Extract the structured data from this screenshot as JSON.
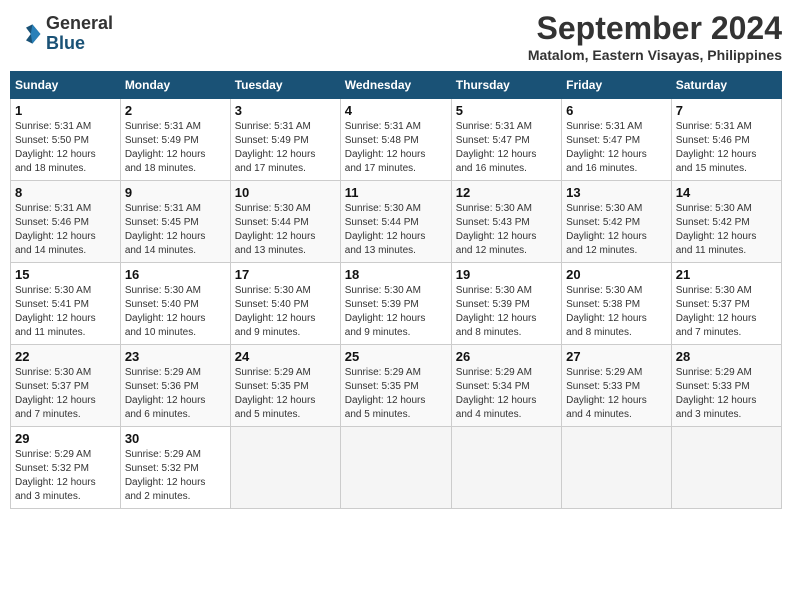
{
  "header": {
    "logo_line1": "General",
    "logo_line2": "Blue",
    "month": "September 2024",
    "location": "Matalom, Eastern Visayas, Philippines"
  },
  "weekdays": [
    "Sunday",
    "Monday",
    "Tuesday",
    "Wednesday",
    "Thursday",
    "Friday",
    "Saturday"
  ],
  "weeks": [
    [
      {
        "day": "1",
        "info": "Sunrise: 5:31 AM\nSunset: 5:50 PM\nDaylight: 12 hours\nand 18 minutes."
      },
      {
        "day": "2",
        "info": "Sunrise: 5:31 AM\nSunset: 5:49 PM\nDaylight: 12 hours\nand 18 minutes."
      },
      {
        "day": "3",
        "info": "Sunrise: 5:31 AM\nSunset: 5:49 PM\nDaylight: 12 hours\nand 17 minutes."
      },
      {
        "day": "4",
        "info": "Sunrise: 5:31 AM\nSunset: 5:48 PM\nDaylight: 12 hours\nand 17 minutes."
      },
      {
        "day": "5",
        "info": "Sunrise: 5:31 AM\nSunset: 5:47 PM\nDaylight: 12 hours\nand 16 minutes."
      },
      {
        "day": "6",
        "info": "Sunrise: 5:31 AM\nSunset: 5:47 PM\nDaylight: 12 hours\nand 16 minutes."
      },
      {
        "day": "7",
        "info": "Sunrise: 5:31 AM\nSunset: 5:46 PM\nDaylight: 12 hours\nand 15 minutes."
      }
    ],
    [
      {
        "day": "8",
        "info": "Sunrise: 5:31 AM\nSunset: 5:46 PM\nDaylight: 12 hours\nand 14 minutes."
      },
      {
        "day": "9",
        "info": "Sunrise: 5:31 AM\nSunset: 5:45 PM\nDaylight: 12 hours\nand 14 minutes."
      },
      {
        "day": "10",
        "info": "Sunrise: 5:30 AM\nSunset: 5:44 PM\nDaylight: 12 hours\nand 13 minutes."
      },
      {
        "day": "11",
        "info": "Sunrise: 5:30 AM\nSunset: 5:44 PM\nDaylight: 12 hours\nand 13 minutes."
      },
      {
        "day": "12",
        "info": "Sunrise: 5:30 AM\nSunset: 5:43 PM\nDaylight: 12 hours\nand 12 minutes."
      },
      {
        "day": "13",
        "info": "Sunrise: 5:30 AM\nSunset: 5:42 PM\nDaylight: 12 hours\nand 12 minutes."
      },
      {
        "day": "14",
        "info": "Sunrise: 5:30 AM\nSunset: 5:42 PM\nDaylight: 12 hours\nand 11 minutes."
      }
    ],
    [
      {
        "day": "15",
        "info": "Sunrise: 5:30 AM\nSunset: 5:41 PM\nDaylight: 12 hours\nand 11 minutes."
      },
      {
        "day": "16",
        "info": "Sunrise: 5:30 AM\nSunset: 5:40 PM\nDaylight: 12 hours\nand 10 minutes."
      },
      {
        "day": "17",
        "info": "Sunrise: 5:30 AM\nSunset: 5:40 PM\nDaylight: 12 hours\nand 9 minutes."
      },
      {
        "day": "18",
        "info": "Sunrise: 5:30 AM\nSunset: 5:39 PM\nDaylight: 12 hours\nand 9 minutes."
      },
      {
        "day": "19",
        "info": "Sunrise: 5:30 AM\nSunset: 5:39 PM\nDaylight: 12 hours\nand 8 minutes."
      },
      {
        "day": "20",
        "info": "Sunrise: 5:30 AM\nSunset: 5:38 PM\nDaylight: 12 hours\nand 8 minutes."
      },
      {
        "day": "21",
        "info": "Sunrise: 5:30 AM\nSunset: 5:37 PM\nDaylight: 12 hours\nand 7 minutes."
      }
    ],
    [
      {
        "day": "22",
        "info": "Sunrise: 5:30 AM\nSunset: 5:37 PM\nDaylight: 12 hours\nand 7 minutes."
      },
      {
        "day": "23",
        "info": "Sunrise: 5:29 AM\nSunset: 5:36 PM\nDaylight: 12 hours\nand 6 minutes."
      },
      {
        "day": "24",
        "info": "Sunrise: 5:29 AM\nSunset: 5:35 PM\nDaylight: 12 hours\nand 5 minutes."
      },
      {
        "day": "25",
        "info": "Sunrise: 5:29 AM\nSunset: 5:35 PM\nDaylight: 12 hours\nand 5 minutes."
      },
      {
        "day": "26",
        "info": "Sunrise: 5:29 AM\nSunset: 5:34 PM\nDaylight: 12 hours\nand 4 minutes."
      },
      {
        "day": "27",
        "info": "Sunrise: 5:29 AM\nSunset: 5:33 PM\nDaylight: 12 hours\nand 4 minutes."
      },
      {
        "day": "28",
        "info": "Sunrise: 5:29 AM\nSunset: 5:33 PM\nDaylight: 12 hours\nand 3 minutes."
      }
    ],
    [
      {
        "day": "29",
        "info": "Sunrise: 5:29 AM\nSunset: 5:32 PM\nDaylight: 12 hours\nand 3 minutes."
      },
      {
        "day": "30",
        "info": "Sunrise: 5:29 AM\nSunset: 5:32 PM\nDaylight: 12 hours\nand 2 minutes."
      },
      {
        "day": "",
        "info": ""
      },
      {
        "day": "",
        "info": ""
      },
      {
        "day": "",
        "info": ""
      },
      {
        "day": "",
        "info": ""
      },
      {
        "day": "",
        "info": ""
      }
    ]
  ]
}
